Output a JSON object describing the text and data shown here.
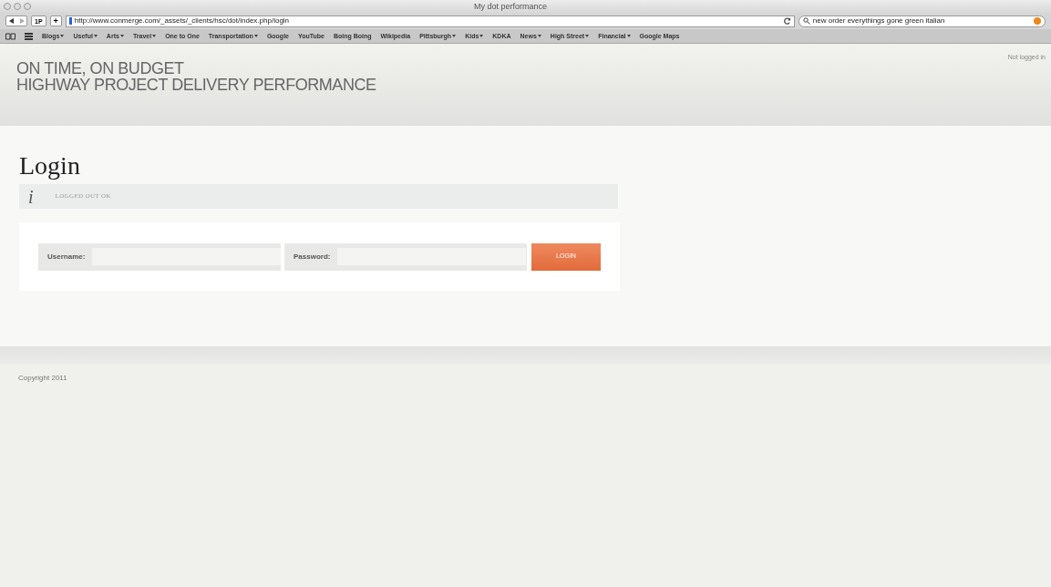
{
  "window": {
    "title": "My dot performance"
  },
  "toolbar": {
    "address": "http://www.conmerge.com/_assets/_clients/hsc/dot/index.php/login",
    "search": "new order everythings gone green italian",
    "onep": "1P",
    "add": "+"
  },
  "bookmarks": [
    {
      "label": "Blogs",
      "menu": true
    },
    {
      "label": "Useful",
      "menu": true
    },
    {
      "label": "Arts",
      "menu": true
    },
    {
      "label": "Travel",
      "menu": true
    },
    {
      "label": "One to One",
      "menu": false
    },
    {
      "label": "Transportation",
      "menu": true
    },
    {
      "label": "Google",
      "menu": false
    },
    {
      "label": "YouTube",
      "menu": false
    },
    {
      "label": "Boing Boing",
      "menu": false
    },
    {
      "label": "Wikipedia",
      "menu": false
    },
    {
      "label": "Pittsburgh",
      "menu": true
    },
    {
      "label": "Kids",
      "menu": true
    },
    {
      "label": "KDKA",
      "menu": false
    },
    {
      "label": "News",
      "menu": true
    },
    {
      "label": "High Street",
      "menu": true
    },
    {
      "label": "Financial",
      "menu": true
    },
    {
      "label": "Google Maps",
      "menu": false
    }
  ],
  "header": {
    "title_line_1": "ON TIME, ON BUDGET",
    "title_line_2": "HIGHWAY PROJECT DELIVERY PERFORMANCE",
    "status": "Not logged in"
  },
  "page": {
    "heading": "Login",
    "notice_icon": "i",
    "notice": "LOGGED OUT OK",
    "username_label": "Username:",
    "password_label": "Password:",
    "login_button": "LOGIN"
  },
  "footer": {
    "copyright": "Copyright 2011"
  }
}
